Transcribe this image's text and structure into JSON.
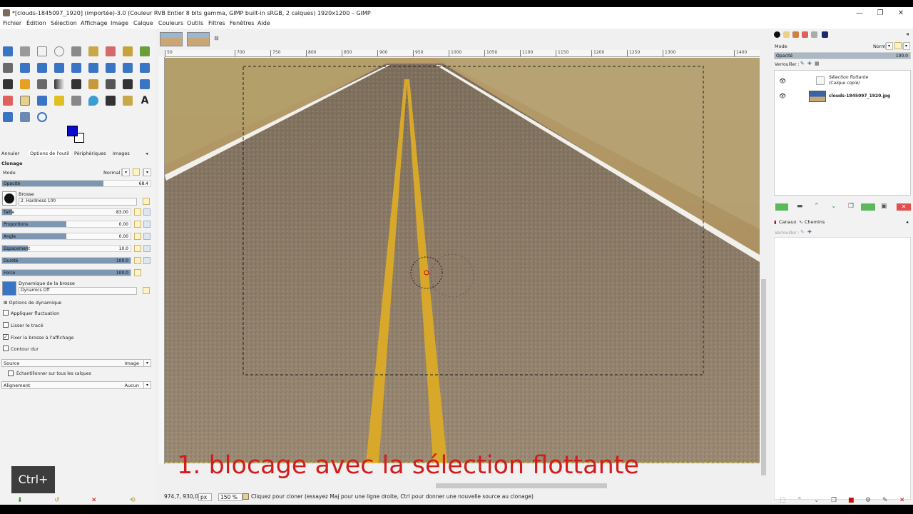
{
  "window": {
    "title": "*[clouds-1845097_1920] (importée)-3.0 (Couleur RVB Entier 8 bits gamma, GIMP built-in sRGB, 2 calques) 1920x1200 – GIMP",
    "minimize": "—",
    "maximize": "❐",
    "close": "✕"
  },
  "menu": [
    "Fichier",
    "Édition",
    "Sélection",
    "Affichage",
    "Image",
    "Calque",
    "Couleurs",
    "Outils",
    "Filtres",
    "Fenêtres",
    "Aide"
  ],
  "dock_tabs": [
    "Annuler",
    "Options de l'outil",
    "Périphériques",
    "Images"
  ],
  "tool_options": {
    "tool_name": "Clonage",
    "mode_label": "Mode",
    "mode_value": "Normal",
    "opacity": {
      "label": "Opacité",
      "value": "68.4",
      "fraction": 0.684
    },
    "brush_label": "Brosse",
    "brush_value": "2. Hardness 100",
    "sliders": [
      {
        "label": "Taille",
        "value": "83.00",
        "fraction": 0.08
      },
      {
        "label": "Proportions",
        "value": "0.00",
        "fraction": 0.5
      },
      {
        "label": "Angle",
        "value": "0.00",
        "fraction": 0.5
      },
      {
        "label": "Espacement",
        "value": "10.0",
        "fraction": 0.2
      },
      {
        "label": "Dureté",
        "value": "100.0",
        "fraction": 1.0
      },
      {
        "label": "Force",
        "value": "100.0",
        "fraction": 1.0
      }
    ],
    "dynamics_label": "Dynamique de la brosse",
    "dynamics_value": "Dynamics Off",
    "dynamics_options": "Options de dynamique",
    "checkboxes": [
      {
        "label": "Appliquer fluctuation",
        "checked": false
      },
      {
        "label": "Lisser le tracé",
        "checked": false
      },
      {
        "label": "Fixer la brosse à l'affichage",
        "checked": true
      },
      {
        "label": "Contour dur",
        "checked": false
      }
    ],
    "source_label": "Source",
    "source_value": "Image",
    "sample_all": "Échantillonner sur tous les calques",
    "align_label": "Alignement",
    "align_value": "Aucun"
  },
  "ruler": [
    "50",
    "700",
    "750",
    "800",
    "850",
    "900",
    "950",
    "1000",
    "1050",
    "1100",
    "1150",
    "1200",
    "1250",
    "1300",
    "1400"
  ],
  "caption": "1. blocage avec la sélection flottante",
  "status": {
    "coords": "974,7, 930,0",
    "unit": "px",
    "zoom": "150 %",
    "message": "Cliquez pour cloner (essayez Maj pour une ligne droite, Ctrl pour donner une nouvelle source au clonage)"
  },
  "layers_panel": {
    "mode_label": "Mode",
    "mode_value": "Normal",
    "opacity_label": "Opacité",
    "opacity_value": "100.0",
    "lock_label": "Verrouiller :",
    "layers": [
      {
        "name": "Sélection flottante",
        "sub": "(Calque copié)"
      },
      {
        "name": "clouds-1845097_1920.jpg",
        "sub": ""
      }
    ]
  },
  "channels_panel": {
    "tabs": [
      "Canaux",
      "Chemins"
    ],
    "lock_label": "Verrouiller :"
  },
  "overlay": {
    "ctrl": "Ctrl+"
  },
  "colors": {
    "fg": "#0a0acc",
    "bg": "#ffffff",
    "caption": "#d11d1d"
  }
}
